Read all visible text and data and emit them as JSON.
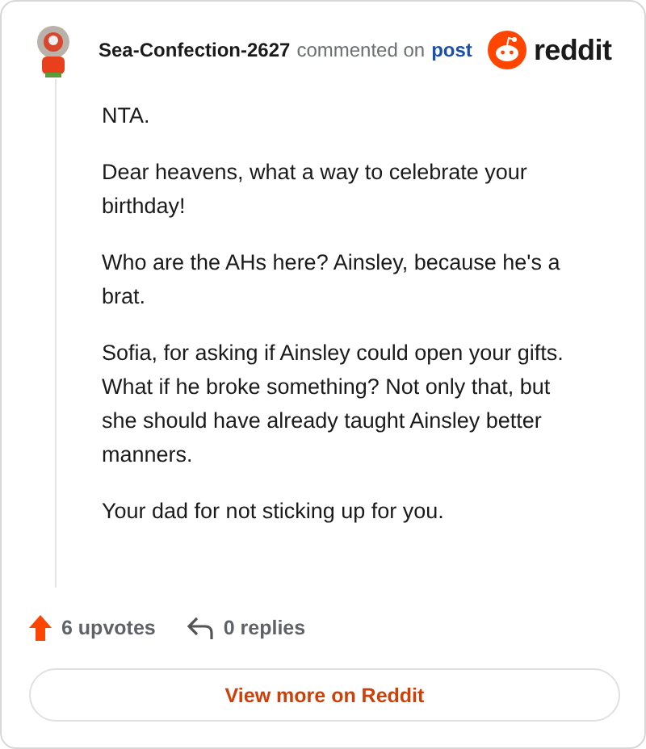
{
  "comment": {
    "author": "Sea-Confection-2627",
    "action": "commented on",
    "target": "post",
    "brand": "reddit",
    "paragraphs": [
      "NTA.",
      "Dear heavens, what a way to celebrate your birthday!",
      "Who are the AHs here? Ainsley, because he's a brat.",
      "Sofia, for asking if Ainsley could open your gifts. What if he broke something? Not only that, but she should have already taught Ainsley better manners.",
      "Your dad for not sticking up for you."
    ],
    "upvotes": "6 upvotes",
    "replies": "0 replies"
  },
  "button": "View more on Reddit"
}
